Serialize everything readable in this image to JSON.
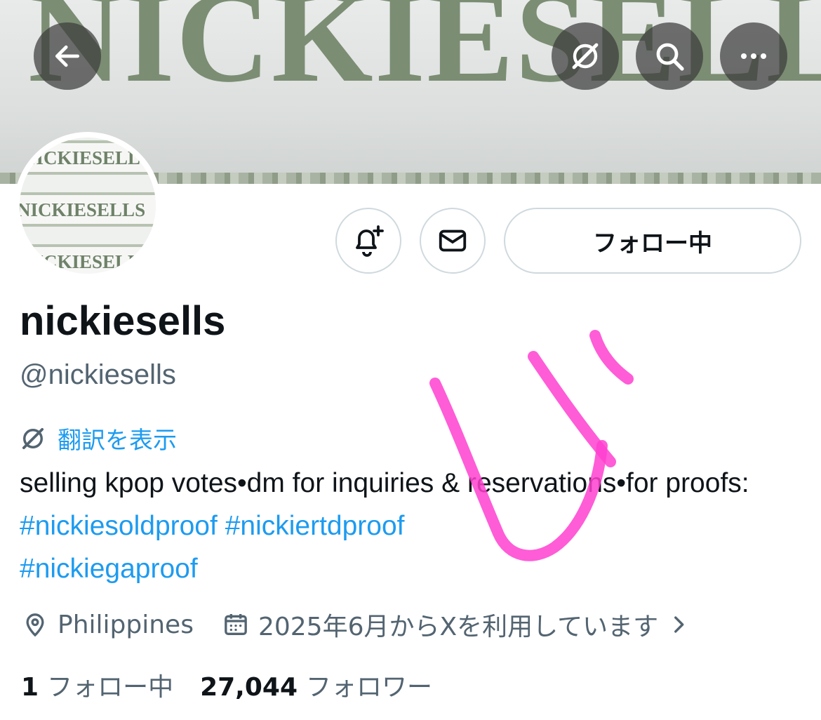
{
  "banner": {
    "text": "NICKIESELLS"
  },
  "avatar": {
    "lines": [
      "NICKIESELLS",
      "NICKIESELLS",
      "NICKIESELLS"
    ]
  },
  "nav": {
    "back_icon": "arrow-left-icon",
    "translate_icon": "translate-off-icon",
    "search_icon": "search-icon",
    "more_icon": "more-icon"
  },
  "actions": {
    "notify_icon": "bell-plus-icon",
    "message_icon": "envelope-icon",
    "follow_label": "フォロー中"
  },
  "profile": {
    "name": "nickiesells",
    "handle": "@nickiesells",
    "translate_label": "翻訳を表示",
    "bio_text_1": "selling kpop votes•dm for inquiries & reservations•for proofs: ",
    "hashtag_1": "#nickiesoldproof",
    "hashtag_2": "#nickiertdproof",
    "hashtag_3": "#nickiegaproof",
    "location": "Philippines",
    "joined": "2025年6月からXを利用しています"
  },
  "stats": {
    "following_count": "1",
    "following_label": "フォロー中",
    "followers_count": "27,044",
    "followers_label": "フォロワー"
  },
  "colors": {
    "accent": "#1d9bf0",
    "secondary_text": "#536471",
    "annotation": "#ff3fd0"
  }
}
